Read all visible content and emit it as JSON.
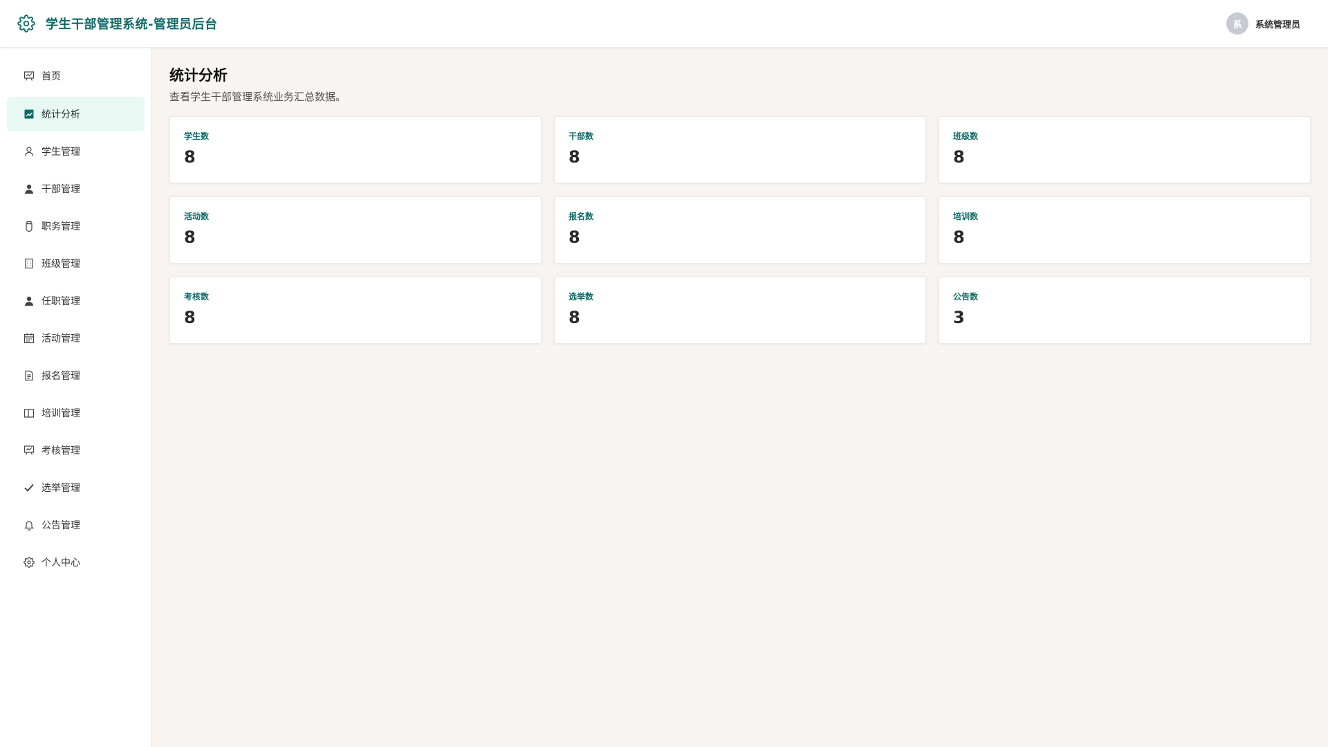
{
  "header": {
    "title": "学生干部管理系统-管理员后台",
    "logo_icon": "gear-icon",
    "user": {
      "avatar_text": "系",
      "name": "系统管理员"
    }
  },
  "sidebar": {
    "items": [
      {
        "label": "首页",
        "icon": "presentation-icon",
        "active": false
      },
      {
        "label": "统计分析",
        "icon": "chart-icon",
        "active": true
      },
      {
        "label": "学生管理",
        "icon": "user-outline-icon",
        "active": false
      },
      {
        "label": "干部管理",
        "icon": "user-filled-icon",
        "active": false
      },
      {
        "label": "职务管理",
        "icon": "badge-icon",
        "active": false
      },
      {
        "label": "班级管理",
        "icon": "building-icon",
        "active": false
      },
      {
        "label": "任职管理",
        "icon": "user-filled-icon",
        "active": false
      },
      {
        "label": "活动管理",
        "icon": "calendar-icon",
        "active": false
      },
      {
        "label": "报名管理",
        "icon": "document-icon",
        "active": false
      },
      {
        "label": "培训管理",
        "icon": "book-icon",
        "active": false
      },
      {
        "label": "考核管理",
        "icon": "presentation-icon",
        "active": false
      },
      {
        "label": "选举管理",
        "icon": "check-icon",
        "active": false
      },
      {
        "label": "公告管理",
        "icon": "bell-icon",
        "active": false
      },
      {
        "label": "个人中心",
        "icon": "gear-icon",
        "active": false
      }
    ]
  },
  "main": {
    "title": "统计分析",
    "description": "查看学生干部管理系统业务汇总数据。",
    "stats": [
      {
        "label": "学生数",
        "value": "8"
      },
      {
        "label": "干部数",
        "value": "8"
      },
      {
        "label": "班级数",
        "value": "8"
      },
      {
        "label": "活动数",
        "value": "8"
      },
      {
        "label": "报名数",
        "value": "8"
      },
      {
        "label": "培训数",
        "value": "8"
      },
      {
        "label": "考核数",
        "value": "8"
      },
      {
        "label": "选举数",
        "value": "8"
      },
      {
        "label": "公告数",
        "value": "3"
      }
    ]
  },
  "colors": {
    "brand": "#0f6b66",
    "active_bg": "#e8f8f3",
    "page_bg": "#f7f4f1"
  }
}
